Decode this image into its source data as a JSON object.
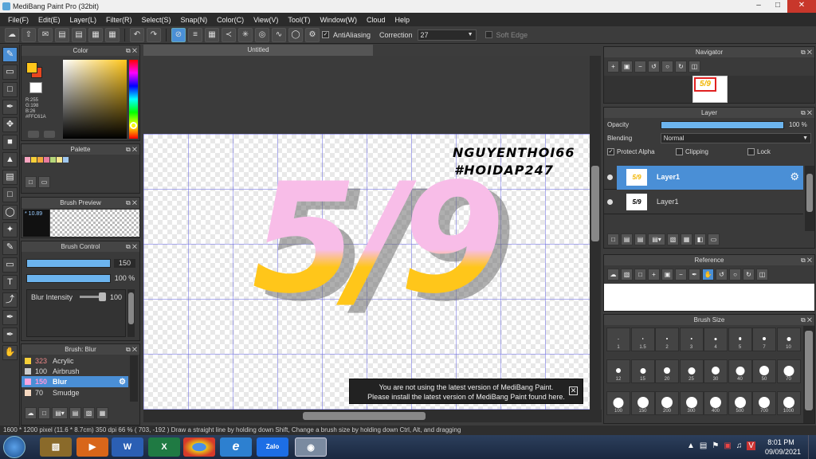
{
  "app": {
    "title": "MediBang Paint Pro (32bit)"
  },
  "menu": [
    "File(F)",
    "Edit(E)",
    "Layer(L)",
    "Filter(R)",
    "Select(S)",
    "Snap(N)",
    "Color(C)",
    "View(V)",
    "Tool(T)",
    "Window(W)",
    "Cloud",
    "Help"
  ],
  "toolbar": {
    "antialiasing_label": "AntiAliasing",
    "correction_label": "Correction",
    "correction_value": "27",
    "soft_edge_label": "Soft Edge"
  },
  "color_panel": {
    "title": "Color",
    "r": "R:255",
    "g": "G:198",
    "b": "B:26",
    "hex": "#FFC61A",
    "primary_color": "#ffc61a",
    "secondary_color": "#e8461f"
  },
  "palette_panel": {
    "title": "Palette",
    "swatches": [
      "#f9a5c0",
      "#f7d038",
      "#f2a83b",
      "#e87b9d",
      "#b6d77a",
      "#f6e58d",
      "#9fc7ef"
    ]
  },
  "brush_preview": {
    "title": "Brush Preview",
    "size": "10.89"
  },
  "brush_control": {
    "title": "Brush Control",
    "size_value": "150",
    "opacity_value": "100 %",
    "blur_label": "Blur Intensity",
    "blur_value": "100"
  },
  "brush_list": {
    "title": "Brush: Blur",
    "items": [
      {
        "num": "323",
        "name": "Acrylic",
        "swatch": "#f7d038"
      },
      {
        "num": "100",
        "name": "Airbrush",
        "swatch": "#cccccc"
      },
      {
        "num": "150",
        "name": "Blur",
        "swatch": "#f9a5e0"
      },
      {
        "num": "70",
        "name": "Smudge",
        "swatch": "#f6d8c0"
      }
    ]
  },
  "document": {
    "tab": "Untitled",
    "signature_line1": "NGUYENTHOI66",
    "signature_line2": "#HOIDAP247",
    "artwork_text": "5/9"
  },
  "notice": {
    "line1": "You are not using the latest version of MediBang Paint.",
    "line2": "Please install the latest version of MediBang Paint found here."
  },
  "navigator": {
    "title": "Navigator",
    "thumb_text": "5/9"
  },
  "layer_panel": {
    "title": "Layer",
    "opacity_label": "Opacity",
    "opacity_value": "100 %",
    "opacity_fraction": 1.0,
    "blending_label": "Blending",
    "blending_value": "Normal",
    "protect_alpha": "Protect Alpha",
    "clipping": "Clipping",
    "lock": "Lock",
    "layers": [
      {
        "name": "Layer1",
        "thumb": "5/9"
      },
      {
        "name": "Layer1",
        "thumb": "5/9"
      }
    ]
  },
  "reference_panel": {
    "title": "Reference"
  },
  "brush_size_panel": {
    "title": "Brush Size",
    "sizes": [
      "1",
      "1.5",
      "2",
      "3",
      "4",
      "5",
      "7",
      "10",
      "12",
      "15",
      "20",
      "25",
      "30",
      "40",
      "50",
      "70",
      "100",
      "150",
      "200",
      "300",
      "400",
      "500",
      "700",
      "1000"
    ]
  },
  "status": {
    "text": "1600 * 1200 pixel   (11.6 * 8.7cm)   350 dpi   66 %   ( 703, -192 )   Draw a straight line by holding down Shift, Change a brush size by holding down Ctrl, Alt, and dragging"
  },
  "taskbar": {
    "time": "8:01 PM",
    "date": "09/09/2021",
    "apps": [
      "W",
      "X",
      "e",
      "Zalo"
    ]
  }
}
